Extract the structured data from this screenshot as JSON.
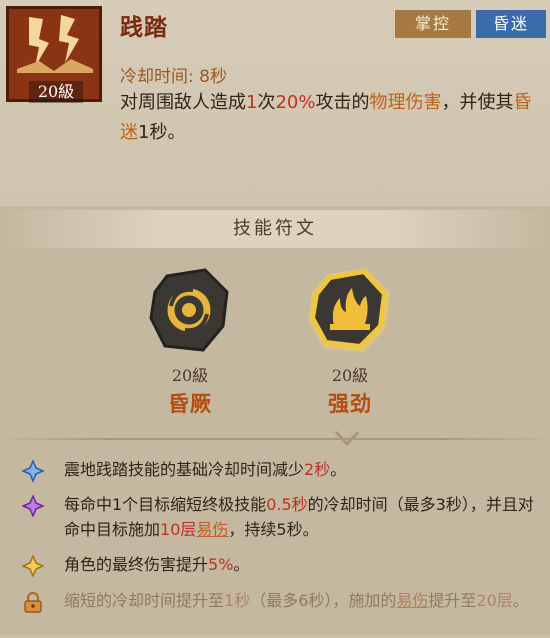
{
  "skill": {
    "name": "践踏",
    "level": "20級",
    "tags": [
      "掌控",
      "昏迷"
    ],
    "cooldown": "冷却时间: 8秒",
    "desc": {
      "p1": "对周围敌人造成",
      "count": "1",
      "p2": "次",
      "pct": "20%",
      "p3": "攻击的",
      "dmg_type": "物理伤害",
      "p4": "，并使其",
      "status": "昏迷",
      "p5": "1秒。"
    }
  },
  "runes": {
    "title": "技能符文",
    "items": [
      {
        "level": "20級",
        "name": "昏厥"
      },
      {
        "level": "20級",
        "name": "强劲"
      }
    ]
  },
  "effects": [
    {
      "icon": "blue-diamond-icon",
      "a": "震地践踏技能的基础冷却时间减少",
      "b": "2秒",
      "c": "。"
    },
    {
      "icon": "purple-diamond-icon",
      "a": "每命中1个目标缩短终极技能",
      "b": "0.5秒",
      "c": "的冷却时间（最多3秒），并且对命中目标施加",
      "d": "10层",
      "e": "易伤",
      "f": "，持续5秒。"
    },
    {
      "icon": "gold-diamond-icon",
      "a": "角色的最终伤害提升",
      "b": "5%",
      "c": "。"
    },
    {
      "icon": "lock-icon",
      "a": "缩短的冷却时间提升至",
      "b": "1秒",
      "c": "（最多6秒），施加的",
      "d": "易伤",
      "e": "提升至",
      "f": "20层",
      "g": "。"
    }
  ],
  "colors": {
    "accent_red": "#c03020",
    "accent_orange": "#c0601f",
    "tag_blue": "#3b6ba8",
    "tag_gold": "#a77a44"
  }
}
